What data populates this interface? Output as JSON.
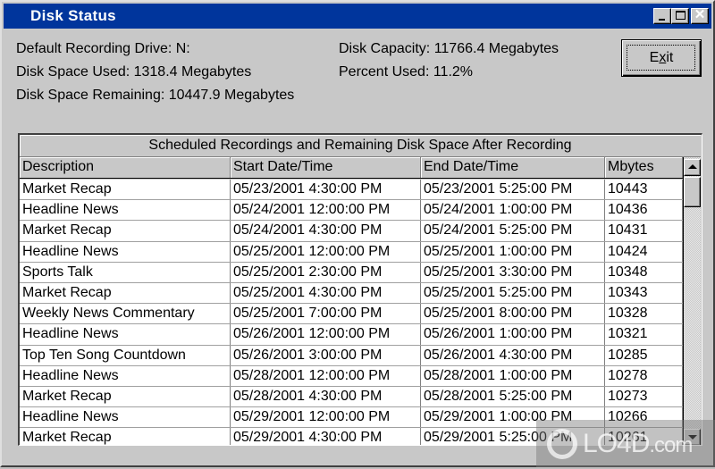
{
  "window": {
    "title": "Disk Status",
    "controls": {
      "minimize": "minimize-icon",
      "maximize": "maximize-icon",
      "close": "close-icon",
      "close_glyph": "✕"
    }
  },
  "info": {
    "default_drive": "Default Recording Drive: N:",
    "space_used": "Disk Space Used: 1318.4 Megabytes",
    "space_remaining": "Disk Space Remaining: 10447.9 Megabytes",
    "capacity": "Disk Capacity: 11766.4 Megabytes",
    "percent_used": "Percent Used: 11.2%"
  },
  "exit_button": {
    "label_prefix": "E",
    "label_mnemonic": "x",
    "label_suffix": "it"
  },
  "grid": {
    "caption": "Scheduled Recordings and Remaining Disk Space After Recording",
    "columns": [
      "Description",
      "Start Date/Time",
      "End Date/Time",
      "Mbytes"
    ],
    "rows": [
      [
        "Market Recap",
        "05/23/2001 4:30:00 PM",
        "05/23/2001 5:25:00 PM",
        "10443"
      ],
      [
        "Headline News",
        "05/24/2001 12:00:00 PM",
        "05/24/2001 1:00:00 PM",
        "10436"
      ],
      [
        "Market Recap",
        "05/24/2001 4:30:00 PM",
        "05/24/2001 5:25:00 PM",
        "10431"
      ],
      [
        "Headline News",
        "05/25/2001 12:00:00 PM",
        "05/25/2001 1:00:00 PM",
        "10424"
      ],
      [
        "Sports Talk",
        "05/25/2001 2:30:00 PM",
        "05/25/2001 3:30:00 PM",
        "10348"
      ],
      [
        "Market Recap",
        "05/25/2001 4:30:00 PM",
        "05/25/2001 5:25:00 PM",
        "10343"
      ],
      [
        "Weekly News Commentary",
        "05/25/2001 7:00:00 PM",
        "05/25/2001 8:00:00 PM",
        "10328"
      ],
      [
        "Headline News",
        "05/26/2001 12:00:00 PM",
        "05/26/2001 1:00:00 PM",
        "10321"
      ],
      [
        "Top Ten Song Countdown",
        "05/26/2001 3:00:00 PM",
        "05/26/2001 4:30:00 PM",
        "10285"
      ],
      [
        "Headline News",
        "05/28/2001 12:00:00 PM",
        "05/28/2001 1:00:00 PM",
        "10278"
      ],
      [
        "Market Recap",
        "05/28/2001 4:30:00 PM",
        "05/28/2001 5:25:00 PM",
        "10273"
      ],
      [
        "Headline News",
        "05/29/2001 12:00:00 PM",
        "05/29/2001 1:00:00 PM",
        "10266"
      ],
      [
        "Market Recap",
        "05/29/2001 4:30:00 PM",
        "05/29/2001 5:25:00 PM",
        "10261"
      ]
    ]
  },
  "watermark": {
    "text_main": "LO4D",
    "text_suffix": ".com"
  }
}
